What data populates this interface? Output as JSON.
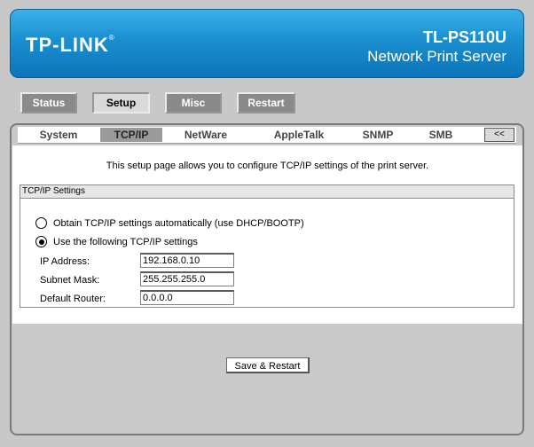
{
  "brand": {
    "logo_text": "TP-LINK",
    "logo_mark": "®",
    "model": "TL-PS110U",
    "product": "Network Print Server"
  },
  "main_nav": {
    "status": "Status",
    "setup": "Setup",
    "misc": "Misc",
    "restart": "Restart",
    "active": "Setup"
  },
  "sub_nav": {
    "items": [
      "System",
      "TCP/IP",
      "NetWare",
      "AppleTalk",
      "SNMP",
      "SMB"
    ],
    "active": "TCP/IP",
    "back_label": "<<"
  },
  "page": {
    "intro": "This setup page allows you to configure TCP/IP settings of the print server.",
    "section_title": "TCP/IP Settings",
    "option_dhcp": "Obtain TCP/IP settings automatically (use DHCP/BOOTP)",
    "option_static": "Use the following TCP/IP settings",
    "selected_option": "static",
    "fields": [
      {
        "label": "IP Address:",
        "value": "192.168.0.10"
      },
      {
        "label": "Subnet Mask:",
        "value": "255.255.255.0"
      },
      {
        "label": "Default Router:",
        "value": "0.0.0.0"
      }
    ],
    "save_button": "Save & Restart"
  },
  "colors": {
    "header_top": "#3cb0e8",
    "header_bottom": "#0c74b8",
    "button_gray": "#8a8a8a",
    "page_bg": "#c8c8c8"
  }
}
